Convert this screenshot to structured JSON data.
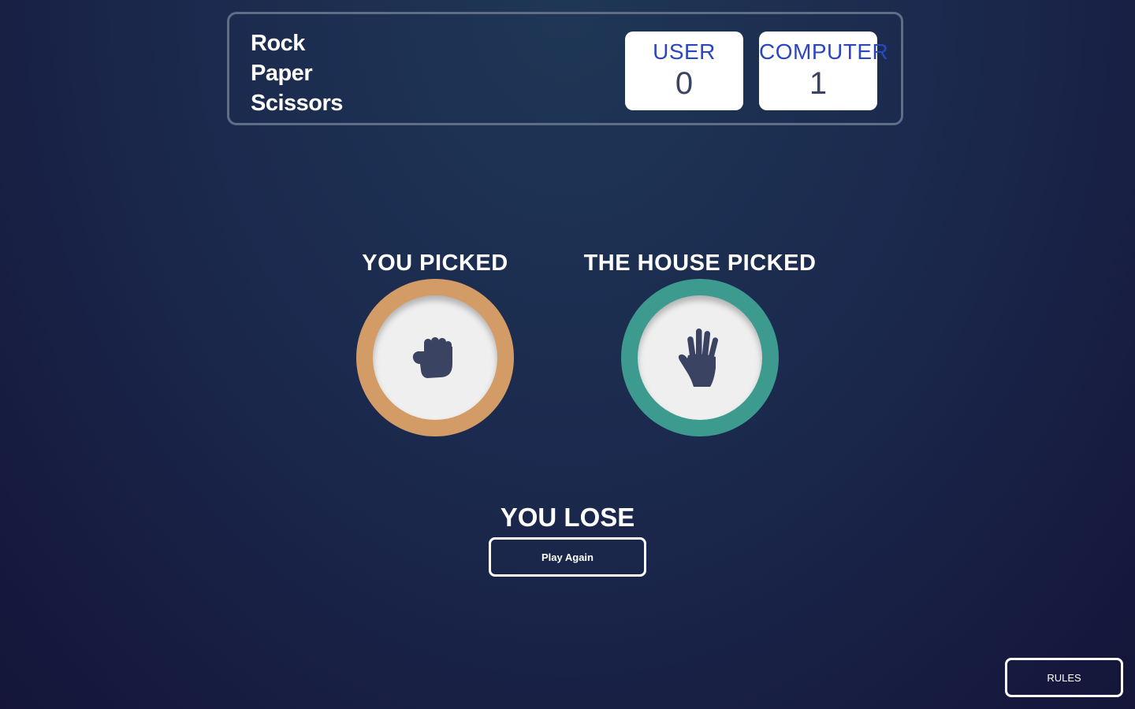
{
  "header": {
    "title_lines": [
      "Rock",
      "Paper",
      "Scissors"
    ],
    "scores": {
      "user": {
        "label": "USER",
        "value": "0"
      },
      "computer": {
        "label": "COMPUTER",
        "value": "1"
      }
    }
  },
  "game": {
    "you_picked_label": "YOU PICKED",
    "house_picked_label": "THE HOUSE PICKED",
    "user_choice": {
      "name": "rock",
      "icon": "fist-icon",
      "ring_color": "#d39c66"
    },
    "house_choice": {
      "name": "paper",
      "icon": "open-hand-icon",
      "ring_color": "#3d9a8f"
    },
    "result_text": "YOU LOSE",
    "play_again_label": "Play Again"
  },
  "footer": {
    "rules_label": "RULES"
  },
  "colors": {
    "score_label": "#2a46c0",
    "score_value": "#3b4363",
    "header_border": "#606e85",
    "icon_fill": "#3b4363"
  }
}
